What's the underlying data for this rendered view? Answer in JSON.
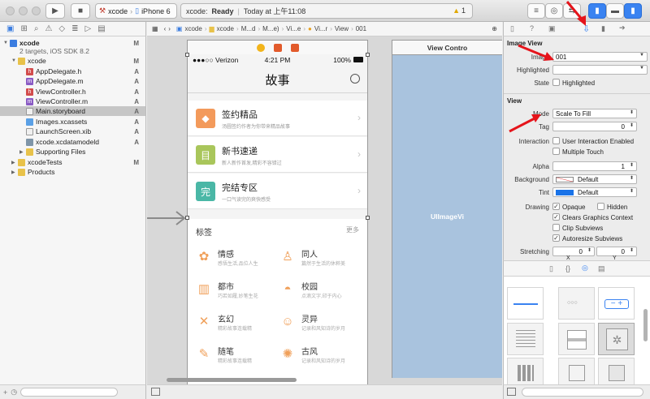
{
  "toolbar": {
    "scheme_name": "xcode",
    "device": "iPhone 6",
    "status_project": "xcode:",
    "status_state": "Ready",
    "status_time": "Today at 上午11:08",
    "warnings_count": "1"
  },
  "navigator": {
    "items": [
      {
        "label": "xcode",
        "status": "M"
      },
      {
        "label": "2 targets, iOS SDK 8.2",
        "status": ""
      },
      {
        "label": "xcode",
        "status": "M"
      },
      {
        "label": "AppDelegate.h",
        "status": "A"
      },
      {
        "label": "AppDelegate.m",
        "status": "A"
      },
      {
        "label": "ViewController.h",
        "status": "A"
      },
      {
        "label": "ViewController.m",
        "status": "A"
      },
      {
        "label": "Main.storyboard",
        "status": "A"
      },
      {
        "label": "Images.xcassets",
        "status": "A"
      },
      {
        "label": "LaunchScreen.xib",
        "status": "A"
      },
      {
        "label": "xcode.xcdatamodeld",
        "status": "A"
      },
      {
        "label": "Supporting Files",
        "status": ""
      },
      {
        "label": "xcodeTests",
        "status": "M"
      },
      {
        "label": "Products",
        "status": ""
      }
    ]
  },
  "jumpbar": {
    "crumbs": [
      "xcode",
      "xcode",
      "M...d",
      "M...e)",
      "Vi...e",
      "Vi...r",
      "View",
      "001"
    ]
  },
  "phone": {
    "carrier": "●●●○○ Verizon",
    "time": "4:21 PM",
    "battery": "100%",
    "title": "故事",
    "cards": [
      {
        "icon": "◆",
        "color": "#f39a5b",
        "title": "签约精品",
        "subtitle": "汤圆签约作者为你带来精品故事"
      },
      {
        "icon": "目",
        "color": "#a9c65b",
        "title": "新书速递",
        "subtitle": "新人新作首发,精彩不容错过"
      },
      {
        "icon": "完",
        "color": "#4ab7a6",
        "title": "完结专区",
        "subtitle": "一口气读完的爽快感受"
      }
    ],
    "tags_title": "标签",
    "tags_more": "更多",
    "tags": [
      {
        "icon": "✿",
        "title": "情感",
        "subtitle": "感悟生活,品位人生"
      },
      {
        "icon": "♙",
        "title": "同人",
        "subtitle": "篇然于生活的休粹美"
      },
      {
        "icon": "▥",
        "title": "都市",
        "subtitle": "巧若如履,妙笔生花"
      },
      {
        "icon": "◓",
        "title": "校园",
        "subtitle": "点滴文字,印于内心"
      },
      {
        "icon": "✕",
        "title": "玄幻",
        "subtitle": "精彩故事连载精"
      },
      {
        "icon": "☺",
        "title": "灵异",
        "subtitle": "记录和风知诗的岁月"
      },
      {
        "icon": "✎",
        "title": "随笔",
        "subtitle": "精彩故事连载精"
      },
      {
        "icon": "✺",
        "title": "古风",
        "subtitle": "记录和风知诗的岁月"
      }
    ]
  },
  "second_vc": {
    "title": "View Contro",
    "image_view_label": "UIImageVi"
  },
  "inspector": {
    "image_view_section": "Image View",
    "image_label": "Image",
    "image_value": "001",
    "highlighted_label": "Highlighted",
    "highlighted_value": "",
    "state_label": "State",
    "state_checkbox": "Highlighted",
    "view_section": "View",
    "mode_label": "Mode",
    "mode_value": "Scale To Fill",
    "tag_label": "Tag",
    "tag_value": "0",
    "interaction_label": "Interaction",
    "user_interaction": "User Interaction Enabled",
    "multiple_touch": "Multiple Touch",
    "alpha_label": "Alpha",
    "alpha_value": "1",
    "background_label": "Background",
    "background_value": "Default",
    "tint_label": "Tint",
    "tint_value": "Default",
    "drawing_label": "Drawing",
    "opaque": "Opaque",
    "hidden": "Hidden",
    "clears_graphics": "Clears Graphics Context",
    "clip_subviews": "Clip Subviews",
    "autoresize": "Autoresize Subviews",
    "stretching_label": "Stretching",
    "stretch_x": "0",
    "stretch_y": "0",
    "x_label": "X",
    "y_label": "Y"
  },
  "colors": {
    "accent": "#1a73e8",
    "arrow": "#e5141b",
    "selection": "#c6c6c6"
  }
}
